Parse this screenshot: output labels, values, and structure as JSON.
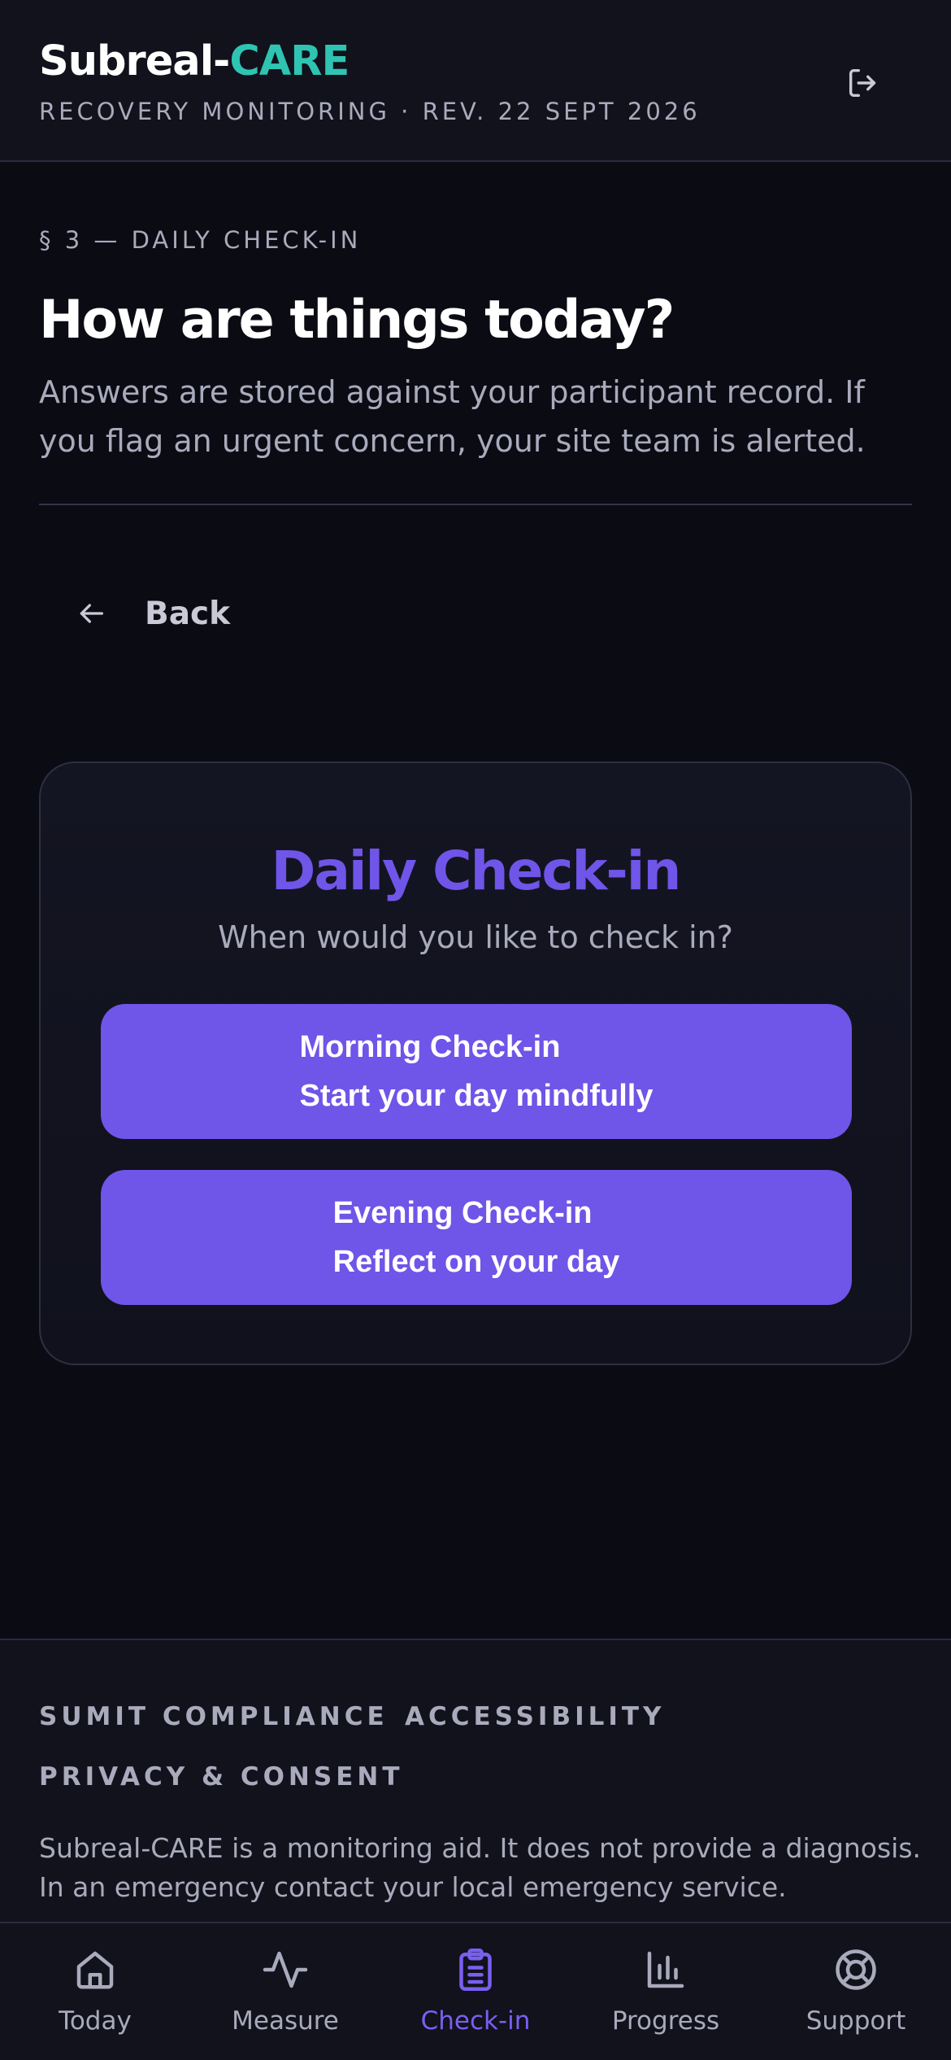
{
  "header": {
    "brand_prefix": "Subreal-",
    "brand_accent": "CARE",
    "subtitle": "RECOVERY MONITORING · REV. 22 SEPT 2026",
    "logout_icon": "logout-icon"
  },
  "section": {
    "label": "§ 3 — DAILY CHECK-IN",
    "title": "How are things today?",
    "lead": "Answers are stored against your participant record. If you flag an urgent concern, your site team is alerted."
  },
  "back": {
    "label": "Back",
    "icon": "arrow-left-icon"
  },
  "card": {
    "title": "Daily Check-in",
    "question": "When would you like to check in?",
    "options": [
      {
        "title": "Morning Check-in",
        "subtitle": "Start your day mindfully"
      },
      {
        "title": "Evening Check-in",
        "subtitle": "Reflect on your day"
      }
    ]
  },
  "footer": {
    "links": [
      "SUMIT COMPLIANCE",
      "ACCESSIBILITY",
      "PRIVACY & CONSENT"
    ],
    "disclaimer": "Subreal-CARE is a monitoring aid. It does not provide a diagnosis. In an emergency contact your local emergency service."
  },
  "tabs": [
    {
      "label": "Today",
      "icon": "home-icon",
      "active": false
    },
    {
      "label": "Measure",
      "icon": "pulse-icon",
      "active": false
    },
    {
      "label": "Check-in",
      "icon": "clipboard-icon",
      "active": true
    },
    {
      "label": "Progress",
      "icon": "bar-chart-icon",
      "active": false
    },
    {
      "label": "Support",
      "icon": "lifebuoy-icon",
      "active": false
    }
  ],
  "colors": {
    "background": "#0b0b14",
    "brand_accent": "#2fc4b2",
    "primary": "#6f55e8",
    "tab_active": "#7a5ff0",
    "muted_text": "#a9aabb"
  }
}
